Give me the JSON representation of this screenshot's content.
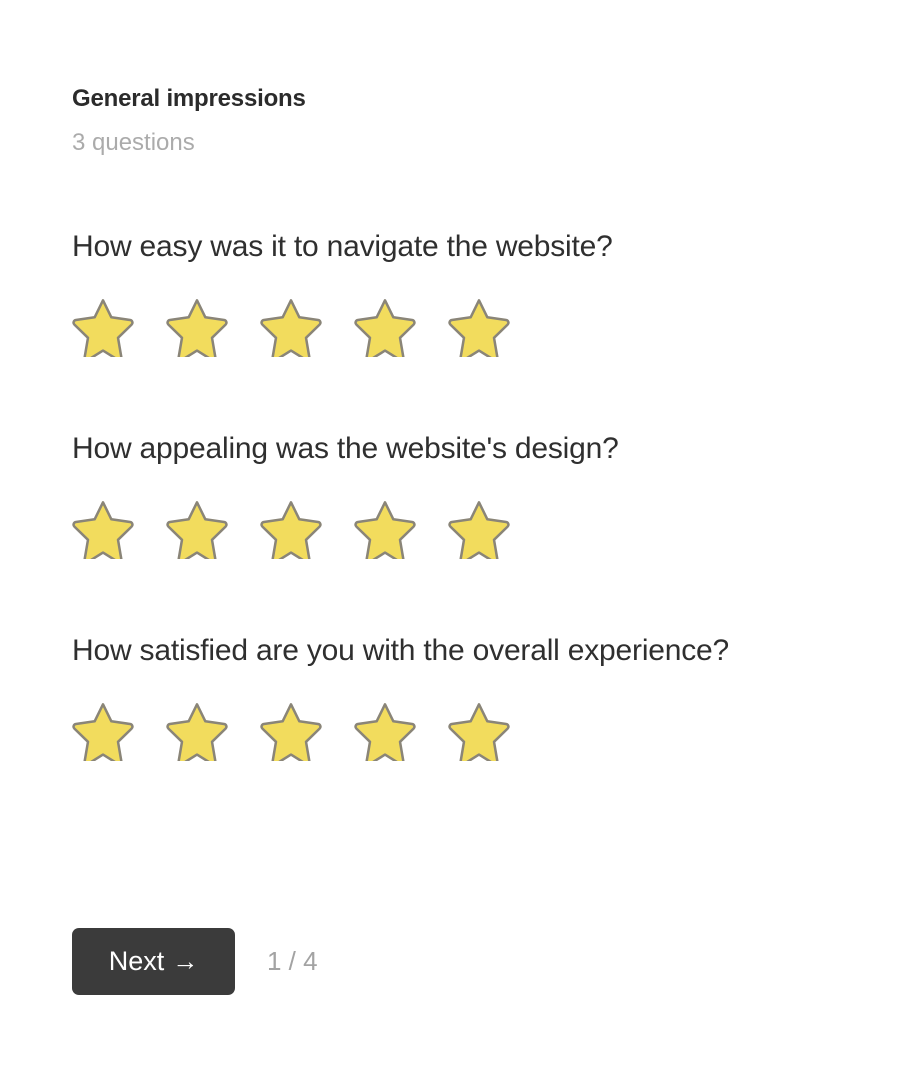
{
  "section": {
    "title": "General impressions",
    "subtitle": "3 questions",
    "question_count": 3
  },
  "questions": [
    {
      "id": "q-navigate",
      "text": "How easy was it to navigate the website?",
      "rating": {
        "max": 5,
        "selected": 0,
        "icon": "star-icon"
      }
    },
    {
      "id": "q-design",
      "text": "How appealing was the website's design?",
      "rating": {
        "max": 5,
        "selected": 0,
        "icon": "star-icon"
      }
    },
    {
      "id": "q-satisfaction",
      "text": "How satisfied are you with the overall experience?",
      "rating": {
        "max": 5,
        "selected": 0,
        "icon": "star-icon"
      }
    }
  ],
  "footer": {
    "next_label": "Next",
    "next_arrow": "→",
    "page_counter": "1 / 4",
    "current_page": 1,
    "total_pages": 4
  },
  "colors": {
    "background": "#ffffff",
    "title_text": "#2b2b2b",
    "subtitle_text": "#ababab",
    "question_text": "#2f2f2f",
    "star_fill": "#f2dc5d",
    "star_stroke": "#8a8578",
    "button_background": "#3b3b3b",
    "button_text": "#ffffff",
    "counter_text": "#a3a3a3"
  }
}
